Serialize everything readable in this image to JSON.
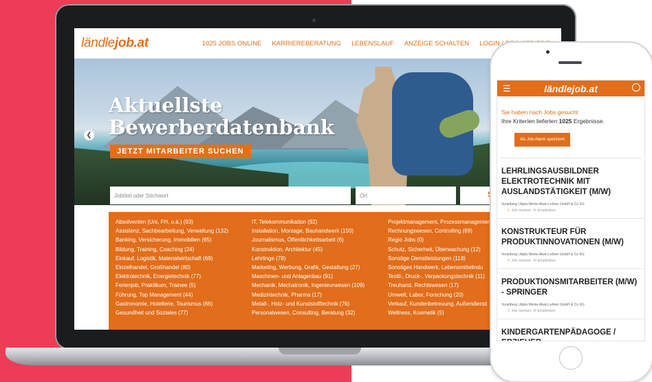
{
  "laptop": {
    "logo": {
      "main": "ländle",
      "accent": "job.at"
    },
    "nav": [
      "1025 JOBS ONLINE",
      "KARRIEREBERATUNG",
      "LEBENSLAUF",
      "ANZEIGE SCHALTEN",
      "LOGIN / REGISTRIEREN"
    ],
    "hero": {
      "title_line1": "Aktuellste",
      "title_line2": "Bewerberdatenbank",
      "cta": "JETZT MITARBEITER SUCHEN",
      "job_placeholder": "Jobtitel oder Stichwort",
      "ort_placeholder": "Ort",
      "search_label": "Suchen"
    },
    "categories": [
      [
        "Absolventen (Uni, FH, o.ä.) (93)",
        "Assistenz, Sachbearbeitung, Verwaltung (132)",
        "Banking, Versicherung, Immobilien (65)",
        "Bildung, Training, Coaching (24)",
        "Einkauf, Logistik, Materialwirtschaft (69)",
        "Einzelhandel, Großhandel (80)",
        "Elektrotechnik, Energietechnik (77)",
        "Ferienjob, Praktikum, Trainee (5)",
        "Führung, Top Management (44)",
        "Gastronomie, Hotellerie, Tourismus (66)",
        "Gesundheit und Soziales (77)"
      ],
      [
        "IT, Telekommunikation (92)",
        "Installation, Montage, Bauhandwerk (150)",
        "Journalismus, Öffentlichkeitsarbeit (6)",
        "Konstruktion, Architektur (45)",
        "Lehrlinge (78)",
        "Marketing, Werbung, Grafik, Gestaltung (27)",
        "Maschinen- und Anlagenbau (91)",
        "Mechanik, Mechatronik, Ingenieurwesen (109)",
        "Medizintechnik, Pharma (17)",
        "Metall-, Holz- und Kunststofftechnik (76)",
        "Personalwesen, Consulting, Beratung (32)"
      ],
      [
        "Projektmanagement, Prozessmanagement",
        "Rechnungswesen, Controlling (69)",
        "Regio Jobs (0)",
        "Schutz, Sicherheit, Überwachung (12)",
        "Sonstige Dienstleistungen (118)",
        "Sonstiges Handwerk, Lebensmittelindu",
        "Textil-, Druck-, Verpackungstechnik (11)",
        "Treuhand, Rechtswesen (17)",
        "Umwelt, Labor, Forschung (20)",
        "Verkauf, Kundenbetreuung, Außendienst",
        "Wellness, Kosmetik (5)"
      ]
    ]
  },
  "phone": {
    "logo": "ländlejob.at",
    "searched_link": "Sie haben nach Jobs gesucht",
    "results_prefix": "Ihre Kriterien lieferten ",
    "results_count": "1025",
    "results_suffix": " Ergebnisse.",
    "alarm_button": "Als Job-Alarm speichern",
    "jobs": [
      {
        "title": "LEHRLINGSAUSBILDNER ELEKTROTECHNIK MIT AUSLANDSTÄTIGKEIT (M/W)",
        "company": "Vorarlberg | Alpla Werke Alwin Lehner GmbH & Co KG",
        "save": "Job merken",
        "recommend": "Empfehlen"
      },
      {
        "title": "KONSTRUKTEUR FÜR PRODUKTINNOVATIONEN (M/W)",
        "company": "Vorarlberg | Alpla Werke Alwin Lehner GmbH & Co KG",
        "save": "Job merken",
        "recommend": "Empfehlen"
      },
      {
        "title": "PRODUKTIONSMITARBEITER (M/W) - SPRINGER",
        "company": "Vorarlberg | Alpla Werke Alwin Lehner GmbH & Co KG",
        "save": "Job merken",
        "recommend": "Empfehlen"
      },
      {
        "title": "KINDERGARTENPÄDAGOGE / ERZIEHER",
        "company": "",
        "save": "",
        "recommend": ""
      }
    ]
  },
  "colors": {
    "brand": "#e26d1a",
    "background_accent": "#ef3c56"
  }
}
